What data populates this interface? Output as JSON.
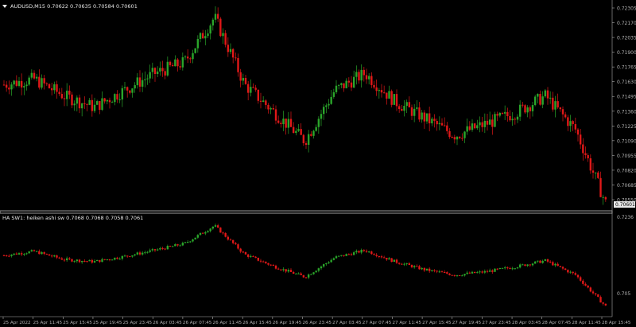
{
  "main_window": {
    "title": "AUDUSD,M15  0.70622 0.70635 0.70584 0.70601",
    "price_axis": [
      "0.72305",
      "0.72170",
      "0.72035",
      "0.71900",
      "0.71765",
      "0.71630",
      "0.71495",
      "0.71360",
      "0.71225",
      "0.71090",
      "0.70955",
      "0.70820",
      "0.70685",
      "0.70550"
    ],
    "current_price": "0.70601"
  },
  "indicator_window": {
    "title": "HA SW1: heiken ashi sw 0.7068 0.7068 0.7058 0.7061",
    "axis_top": "0.7236",
    "axis_bottom": "0.705"
  },
  "time_axis": [
    "25 Apr 2022",
    "25 Apr 11:45",
    "25 Apr 15:45",
    "25 Apr 19:45",
    "25 Apr 23:45",
    "26 Apr 03:45",
    "26 Apr 07:45",
    "26 Apr 11:45",
    "26 Apr 15:45",
    "26 Apr 19:45",
    "26 Apr 23:45",
    "27 Apr 03:45",
    "27 Apr 07:45",
    "27 Apr 11:45",
    "27 Apr 15:45",
    "27 Apr 19:45",
    "27 Apr 23:45",
    "28 Apr 03:45",
    "28 Apr 07:45",
    "28 Apr 11:45",
    "28 Apr 15:45"
  ],
  "colors": {
    "background": "#000000",
    "bull": "#2aa52a",
    "bear": "#e01818",
    "axis": "#b0b0b0",
    "separator": "#9a9a9a",
    "price_tag": "#e8e8e8"
  },
  "chart_data": [
    {
      "type": "line",
      "x": [
        "25 Apr 2022",
        "25 Apr 11:45",
        "25 Apr 15:45",
        "25 Apr 19:45",
        "25 Apr 23:45",
        "26 Apr 03:45",
        "26 Apr 07:45",
        "26 Apr 11:45",
        "26 Apr 15:45",
        "26 Apr 19:45",
        "26 Apr 23:45",
        "27 Apr 03:45",
        "27 Apr 07:45",
        "27 Apr 11:45",
        "27 Apr 15:45",
        "27 Apr 19:45",
        "27 Apr 23:45",
        "28 Apr 03:45",
        "28 Apr 07:45",
        "28 Apr 11:45",
        "28 Apr 15:45"
      ],
      "values": [
        0.7165,
        0.717,
        0.7155,
        0.7145,
        0.716,
        0.7175,
        0.7185,
        0.7225,
        0.7165,
        0.714,
        0.7115,
        0.716,
        0.7175,
        0.715,
        0.7135,
        0.712,
        0.713,
        0.714,
        0.7155,
        0.7125,
        0.706
      ],
      "ylim": [
        0.7055,
        0.7236
      ]
    },
    {
      "type": "line",
      "x": [
        "25 Apr 2022",
        "25 Apr 11:45",
        "25 Apr 15:45",
        "25 Apr 19:45",
        "25 Apr 23:45",
        "26 Apr 03:45",
        "26 Apr 07:45",
        "26 Apr 11:45",
        "26 Apr 15:45",
        "26 Apr 19:45",
        "26 Apr 23:45",
        "27 Apr 03:45",
        "27 Apr 07:45",
        "27 Apr 11:45",
        "27 Apr 15:45",
        "27 Apr 19:45",
        "27 Apr 23:45",
        "28 Apr 03:45",
        "28 Apr 07:45",
        "28 Apr 11:45",
        "28 Apr 15:45"
      ],
      "values": [
        0.716,
        0.7168,
        0.7152,
        0.7148,
        0.7158,
        0.717,
        0.7183,
        0.7218,
        0.7162,
        0.7138,
        0.7118,
        0.7156,
        0.717,
        0.7148,
        0.7132,
        0.7122,
        0.7128,
        0.7138,
        0.715,
        0.7122,
        0.7061
      ],
      "ylim": [
        0.705,
        0.7236
      ]
    }
  ]
}
